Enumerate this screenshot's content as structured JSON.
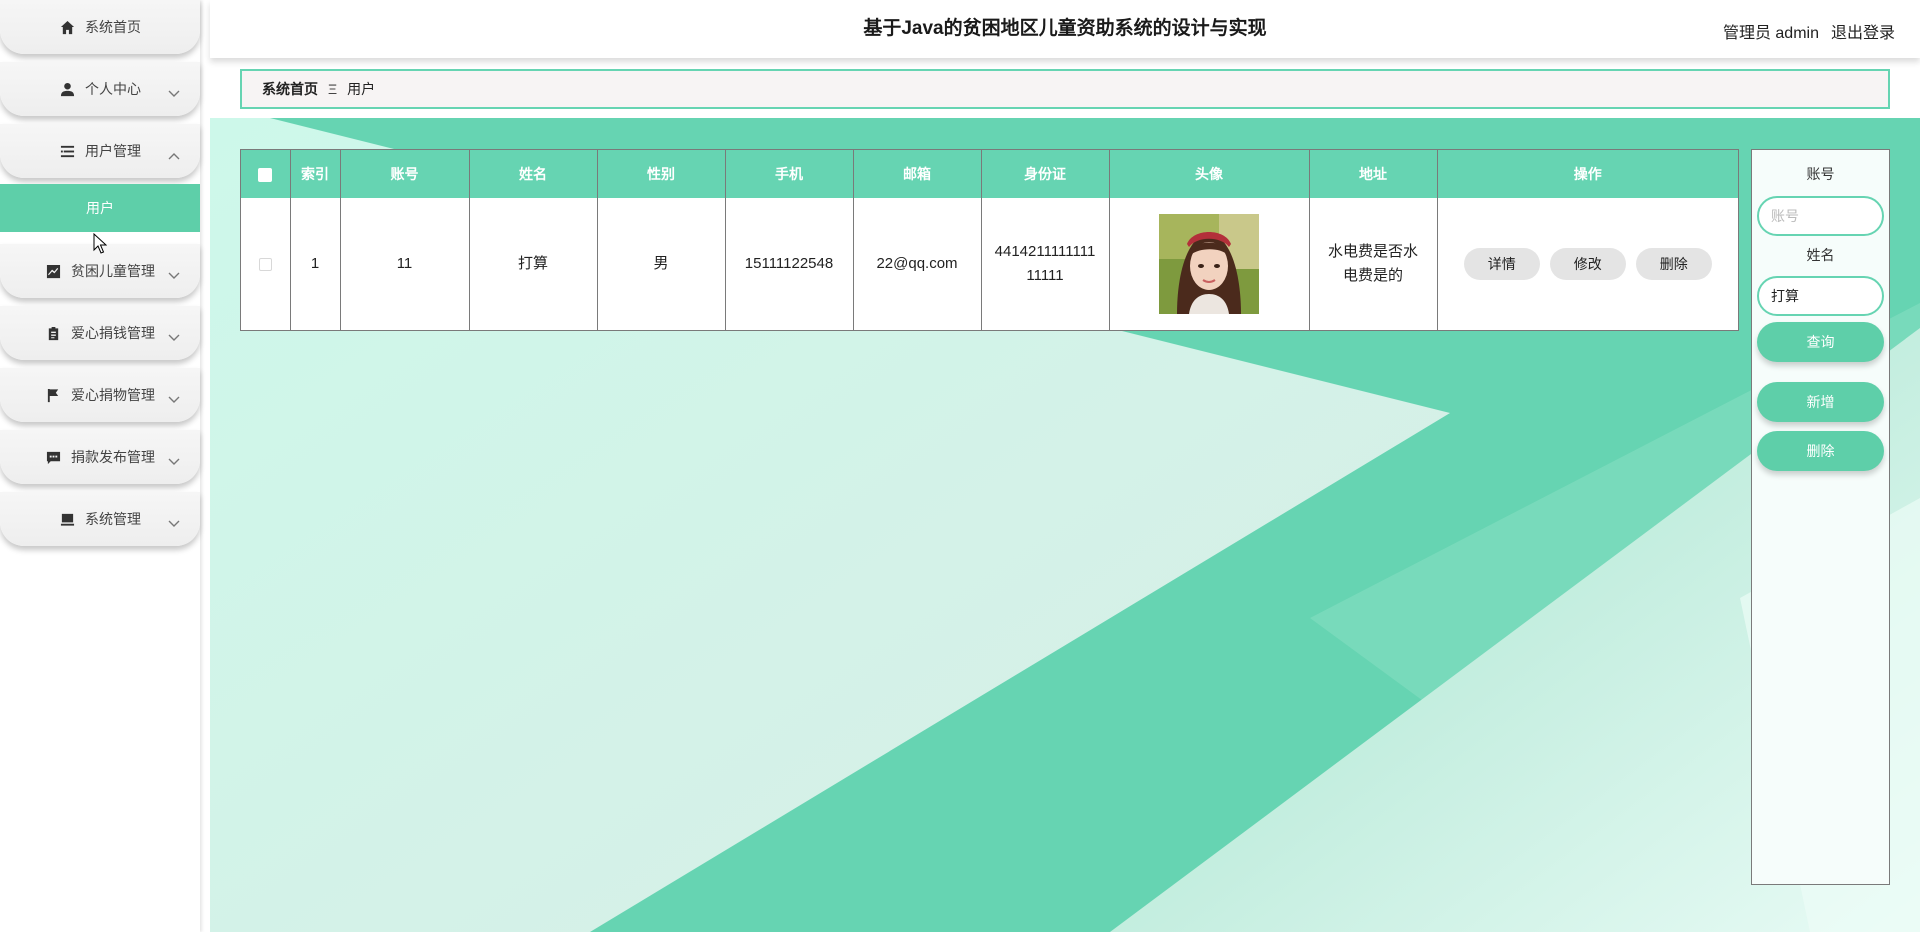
{
  "header": {
    "title": "基于Java的贫困地区儿童资助系统的设计与实现",
    "role": "管理员 admin",
    "logout": "退出登录"
  },
  "sidebar": {
    "items": [
      {
        "label": "系统首页",
        "icon": "home-icon"
      },
      {
        "label": "个人中心",
        "icon": "person-icon"
      },
      {
        "label": "用户管理",
        "icon": "list-icon"
      },
      {
        "label": "贫困儿童管理",
        "icon": "chart-icon"
      },
      {
        "label": "爱心捐钱管理",
        "icon": "clipboard-icon"
      },
      {
        "label": "爱心捐物管理",
        "icon": "flag-icon"
      },
      {
        "label": "捐款发布管理",
        "icon": "chat-icon"
      },
      {
        "label": "系统管理",
        "icon": "computer-icon"
      }
    ],
    "submenu": {
      "label": "用户"
    }
  },
  "breadcrumb": {
    "home": "系统首页",
    "separator": "Ξ",
    "current": "用户"
  },
  "table": {
    "columns": [
      "索引",
      "账号",
      "姓名",
      "性别",
      "手机",
      "邮箱",
      "身份证",
      "头像",
      "地址",
      "操作"
    ],
    "rows": [
      {
        "index": "1",
        "account": "11",
        "name": "打算",
        "gender": "男",
        "phone": "15111122548",
        "email": "22@qq.com",
        "id_card": "441421111111111111",
        "address": "水电费是否水电费是的"
      }
    ],
    "actions": {
      "detail": "详情",
      "edit": "修改",
      "delete": "删除"
    }
  },
  "search": {
    "account_label": "账号",
    "account_placeholder": "账号",
    "account_value": "",
    "name_label": "姓名",
    "name_placeholder": "姓名",
    "name_value": "打算",
    "query_button": "查询",
    "add_button": "新增",
    "delete_button": "删除"
  },
  "colors": {
    "accent": "#66d4b2",
    "accent_dark": "#5ecfa9",
    "button_gray": "#e4e4e4"
  }
}
